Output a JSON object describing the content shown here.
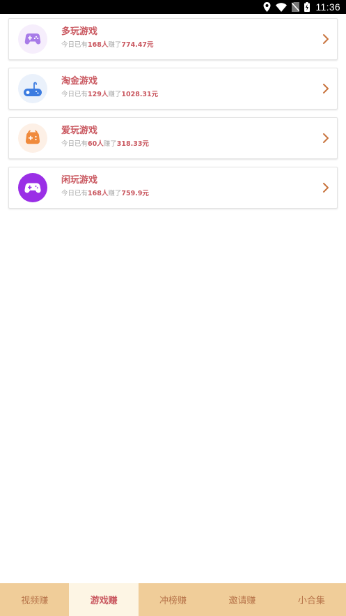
{
  "status_bar": {
    "time": "11:36",
    "icons": [
      "location-icon",
      "wifi-icon",
      "no-sim-icon",
      "battery-charging-icon"
    ]
  },
  "games": [
    {
      "title": "多玩游戏",
      "prefix": "今日已有",
      "count": "168人",
      "mid": "赚了",
      "amount": "774.47元",
      "icon": "gamepad-icon",
      "icon_color": "#a87be8",
      "icon_bg": "#f6eefc"
    },
    {
      "title": "淘金游戏",
      "prefix": "今日已有",
      "count": "129人",
      "mid": "赚了",
      "amount": "1028.31元",
      "icon": "joystick-icon",
      "icon_color": "#3b7be0",
      "icon_bg": "#eaf1fb"
    },
    {
      "title": "爱玩游戏",
      "prefix": "今日已有",
      "count": "60人",
      "mid": "赚了",
      "amount": "318.33元",
      "icon": "gamepad-icon",
      "icon_color": "#f08a3c",
      "icon_bg": "#fdf0e6"
    },
    {
      "title": "闲玩游戏",
      "prefix": "今日已有",
      "count": "168人",
      "mid": "赚了",
      "amount": "759.9元",
      "icon": "controller-icon",
      "icon_color": "#9a2fe6",
      "icon_bg": "#9a2fe6"
    }
  ],
  "tabs": [
    {
      "label": "视频赚",
      "active": false
    },
    {
      "label": "游戏赚",
      "active": true
    },
    {
      "label": "冲榜赚",
      "active": false
    },
    {
      "label": "邀请赚",
      "active": false
    },
    {
      "label": "小合集",
      "active": false
    }
  ]
}
